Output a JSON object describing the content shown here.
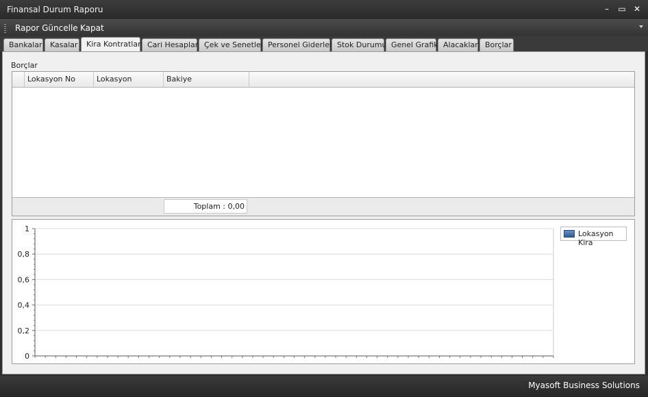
{
  "window": {
    "title": "Finansal Durum Raporu",
    "minimize_glyph": "–",
    "maximize_glyph": "▭",
    "close_glyph": "✕"
  },
  "menu": {
    "refresh": "Rapor Güncelle",
    "close": "Kapat"
  },
  "tabs": [
    "Bankalar",
    "Kasalar",
    "Kira Kontratları",
    "Cari Hesaplar",
    "Çek ve Senetler",
    "Personel Giderleri",
    "Stok Durumu",
    "Genel Grafik",
    "Alacaklar",
    "Borçlar"
  ],
  "active_tab": "Kira Kontratları",
  "group": {
    "title": "Borçlar"
  },
  "grid": {
    "columns": [
      "Lokasyon No",
      "Lokasyon",
      "Bakiye"
    ],
    "rows": [],
    "footer_total": "Toplam : 0,00"
  },
  "chart_data": {
    "type": "bar",
    "title": "",
    "xlabel": "",
    "ylabel": "",
    "categories": [],
    "series": [
      {
        "name": "Lokasyon Kira",
        "values": []
      }
    ],
    "ylim": [
      0,
      1
    ],
    "yticks": [
      "0",
      "0,2",
      "0,4",
      "0,6",
      "0,8",
      "1"
    ],
    "grid": true,
    "legend": "right"
  },
  "status": {
    "company": "Myasoft Business Solutions"
  },
  "colors": {
    "accent": "#2f5b94",
    "chrome": "#2e2e2e"
  }
}
